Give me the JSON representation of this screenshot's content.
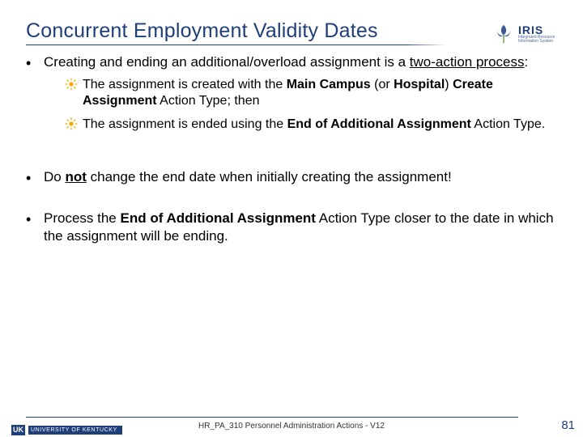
{
  "title": "Concurrent Employment Validity Dates",
  "iris": {
    "name": "IRIS",
    "tag1": "Integrated Resource",
    "tag2": "Information System"
  },
  "bullets": {
    "b1": {
      "pre": "Creating and ending an additional/overload assignment is a ",
      "u": "two-action process",
      "post": ":"
    },
    "b1sub1": {
      "pre": "The assignment is created with the ",
      "bold1": "Main Campus",
      "mid": " (or ",
      "bold2": "Hospital",
      "mid2": ") ",
      "bold3": "Create Assignment",
      "post": " Action Type; then"
    },
    "b1sub2": {
      "pre": "The assignment is ended using the ",
      "bold1": "End of Additional Assignment",
      "post": " Action Type."
    },
    "b2": {
      "pre": "Do ",
      "u": "not",
      "post": " change the end date when initially creating the assignment!"
    },
    "b3": {
      "pre": "Process the ",
      "bold1": "End of Additional Assignment",
      "post": " Action Type closer to the date in which the assignment will be ending."
    }
  },
  "footer": {
    "uk_abbr": "UK",
    "uk_full": "UNIVERSITY OF KENTUCKY",
    "center": "HR_PA_310 Personnel Administration Actions - V12",
    "page": "81"
  }
}
